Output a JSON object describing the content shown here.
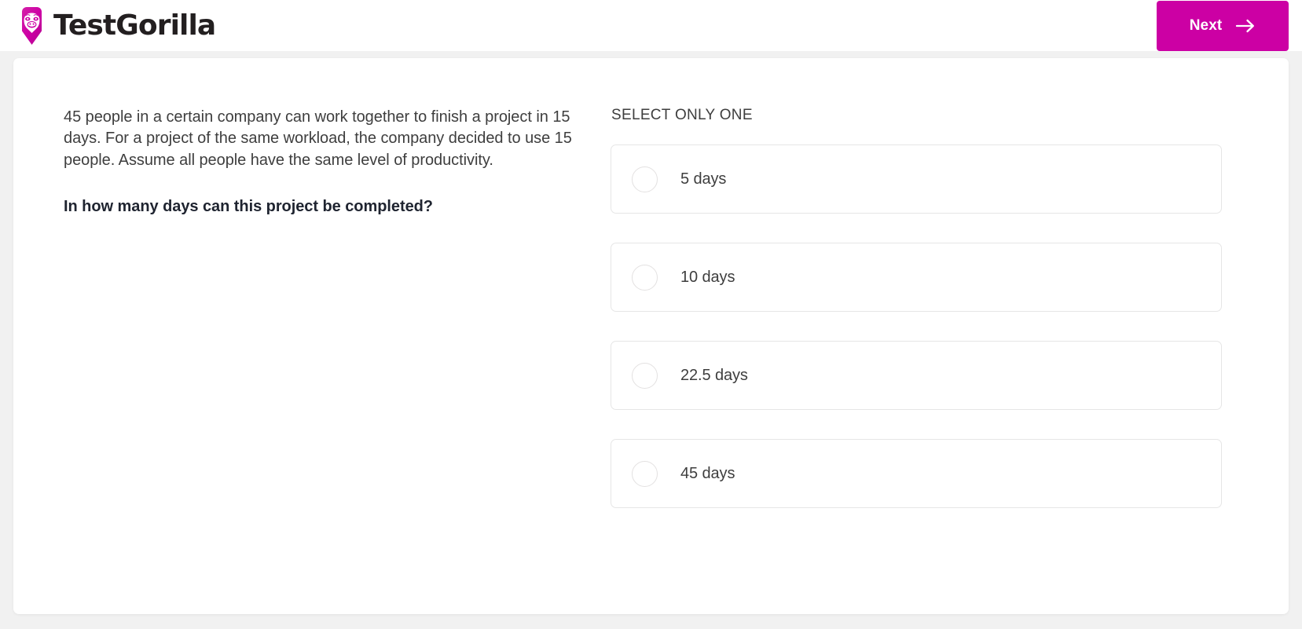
{
  "header": {
    "brand_name": "TestGorilla",
    "brand_icon": "gorilla-logo-icon",
    "brand_color": "#cc00a4",
    "next_label": "Next",
    "next_icon": "arrow-right-icon",
    "next_color": "#cc00a4"
  },
  "question": {
    "body": "45 people in a certain company can work together to finish a project in 15 days. For a project of the same workload, the company decided to use 15 people. Assume all people have the same level of productivity.",
    "prompt": "In how many days can this project be completed?"
  },
  "answers": {
    "heading": "SELECT ONLY ONE",
    "selected": null,
    "options": [
      {
        "label": "5 days",
        "selected": false
      },
      {
        "label": "10 days",
        "selected": false
      },
      {
        "label": "22.5 days",
        "selected": false
      },
      {
        "label": "45 days",
        "selected": false
      }
    ]
  }
}
